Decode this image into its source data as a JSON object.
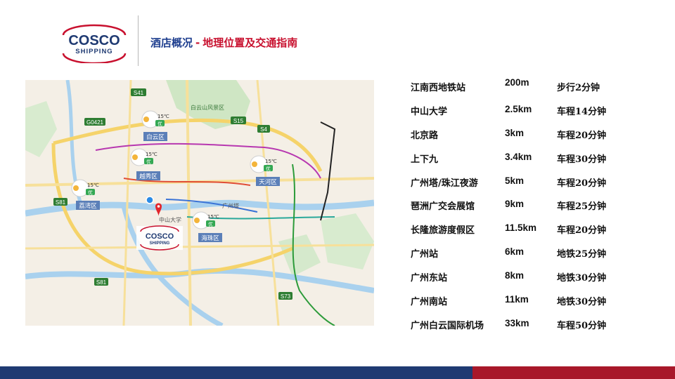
{
  "header": {
    "logo_line1": "COSCO",
    "logo_line2": "SHIPPING",
    "title_main": "酒店概况",
    "title_sep": "-",
    "title_sub": "地理位置及交通指南"
  },
  "map": {
    "district_labels": [
      "白云区",
      "越秀区",
      "荔湾区",
      "天河区",
      "海珠区"
    ],
    "road_badges": [
      "S41",
      "S15",
      "S4",
      "G0421",
      "S81",
      "S81",
      "S73"
    ],
    "weather_temp": "15℃",
    "weather_aqi": "优",
    "park_label": "白云山风景区",
    "marker_logo_line1": "COSCO",
    "marker_logo_line2": "SHIPPING",
    "place_labels": [
      "中山大学",
      "广州塔"
    ]
  },
  "destinations": [
    {
      "name": "江南西地铁站",
      "distance": "200m",
      "time": "步行2分钟"
    },
    {
      "name": "中山大学",
      "distance": "2.5km",
      "time": "车程14分钟"
    },
    {
      "name": "北京路",
      "distance": "3km",
      "time": "车程20分钟"
    },
    {
      "name": "上下九",
      "distance": "3.4km",
      "time": "车程30分钟"
    },
    {
      "name": "广州塔/珠江夜游",
      "distance": "5km",
      "time": "车程20分钟"
    },
    {
      "name": "琶洲广交会展馆",
      "distance": "9km",
      "time": "车程25分钟"
    },
    {
      "name": "长隆旅游度假区",
      "distance": "11.5km",
      "time": "车程20分钟"
    },
    {
      "name": "广州站",
      "distance": "6km",
      "time": "地铁25分钟"
    },
    {
      "name": "广州东站",
      "distance": "8km",
      "time": "地铁30分钟"
    },
    {
      "name": "广州南站",
      "distance": "11km",
      "time": "地铁30分钟"
    },
    {
      "name": "广州白云国际机场",
      "distance": "33km",
      "time": "车程50分钟"
    }
  ],
  "colors": {
    "brand_blue": "#1f3a72",
    "brand_red": "#a8182a",
    "title_blue": "#1f3f8f",
    "title_red": "#c8102e"
  }
}
